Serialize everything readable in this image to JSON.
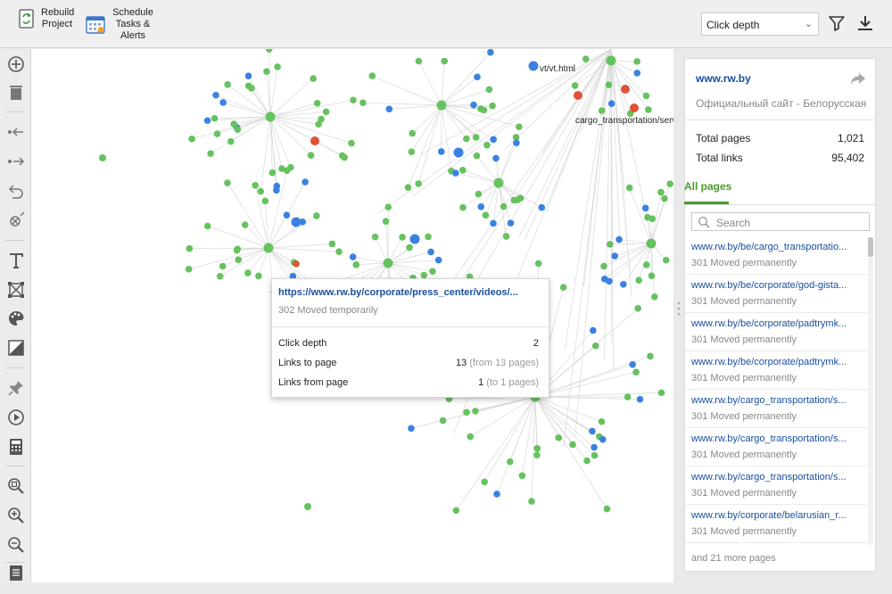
{
  "toolbar": {
    "rebuild_label": "Rebuild Project",
    "schedule_label": "Schedule Tasks & Alerts",
    "view_select": "Click depth"
  },
  "left_tools": [
    "plus-circle-icon",
    "trash-icon",
    "incoming-links-icon",
    "outgoing-links-icon",
    "undo-icon",
    "disable-icon",
    "text-icon",
    "graph-nodes-icon",
    "palette-icon",
    "contrast-icon",
    "pin-icon",
    "play-icon",
    "calculator-icon",
    "zoom-fit-icon",
    "zoom-in-icon",
    "zoom-out-icon",
    "list-icon"
  ],
  "graph": {
    "labels": [
      "vt/vt.html",
      "cargo_transportation/serv"
    ],
    "colors": {
      "html_page": "#66c25e",
      "other_resource": "#3b82e0",
      "error": "#e05237",
      "edge": "#d9d9d9"
    }
  },
  "tooltip": {
    "url": "https://www.rw.by/corporate/press_center/videos/...",
    "status": "302 Moved temporarily",
    "rows": [
      {
        "label": "Click depth",
        "value": "2",
        "note": ""
      },
      {
        "label": "Links to page",
        "value": "13",
        "note": "(from 13 pages)"
      },
      {
        "label": "Links from page",
        "value": "1",
        "note": "(to 1 pages)"
      }
    ]
  },
  "summary": {
    "site": "www.rw.by",
    "description": "Официальный сайт - Белорусская ж",
    "total_pages_label": "Total pages",
    "total_pages": "1,021",
    "total_links_label": "Total links",
    "total_links": "95,402"
  },
  "pages": {
    "tab": "All pages",
    "search_placeholder": "Search",
    "items": [
      {
        "url": "www.rw.by/be/cargo_transportatio...",
        "status": "301 Moved permanently"
      },
      {
        "url": "www.rw.by/be/corporate/god-gista...",
        "status": "301 Moved permanently"
      },
      {
        "url": "www.rw.by/be/corporate/padtrymk...",
        "status": "301 Moved permanently"
      },
      {
        "url": "www.rw.by/be/corporate/padtrymk...",
        "status": "301 Moved permanently"
      },
      {
        "url": "www.rw.by/cargo_transportation/s...",
        "status": "301 Moved permanently"
      },
      {
        "url": "www.rw.by/cargo_transportation/s...",
        "status": "301 Moved permanently"
      },
      {
        "url": "www.rw.by/cargo_transportation/s...",
        "status": "301 Moved permanently"
      },
      {
        "url": "www.rw.by/corporate/belarusian_r...",
        "status": "301 Moved permanently"
      }
    ],
    "more": "and 21 more pages"
  }
}
